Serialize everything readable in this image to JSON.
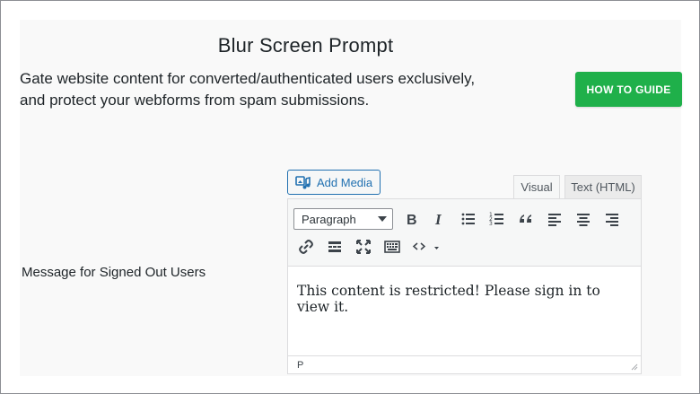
{
  "page": {
    "title": "Blur Screen Prompt",
    "description_line1": "Gate website content for converted/authenticated users exclusively,",
    "description_line2": "and protect your webforms from spam submissions.",
    "guide_button_label": "HOW TO GUIDE"
  },
  "field": {
    "label": "Message for Signed Out Users"
  },
  "editor": {
    "add_media_label": "Add Media",
    "tabs": [
      {
        "label": "Visual",
        "active": true
      },
      {
        "label": "Text (HTML)",
        "active": false
      }
    ],
    "format_select_value": "Paragraph",
    "toolbar_icons": [
      "bold-icon",
      "italic-icon",
      "bulleted-list-icon",
      "numbered-list-icon",
      "blockquote-icon",
      "align-left-icon",
      "align-center-icon",
      "align-right-icon",
      "link-icon",
      "read-more-icon",
      "fullscreen-icon",
      "keyboard-icon",
      "code-icon"
    ],
    "content": "This content is restricted! Please sign in to view it.",
    "status_path": "P"
  },
  "colors": {
    "guide_button": "#1fb04a",
    "accent_blue": "#2271b1",
    "panel_bg": "#f9f9f9"
  }
}
